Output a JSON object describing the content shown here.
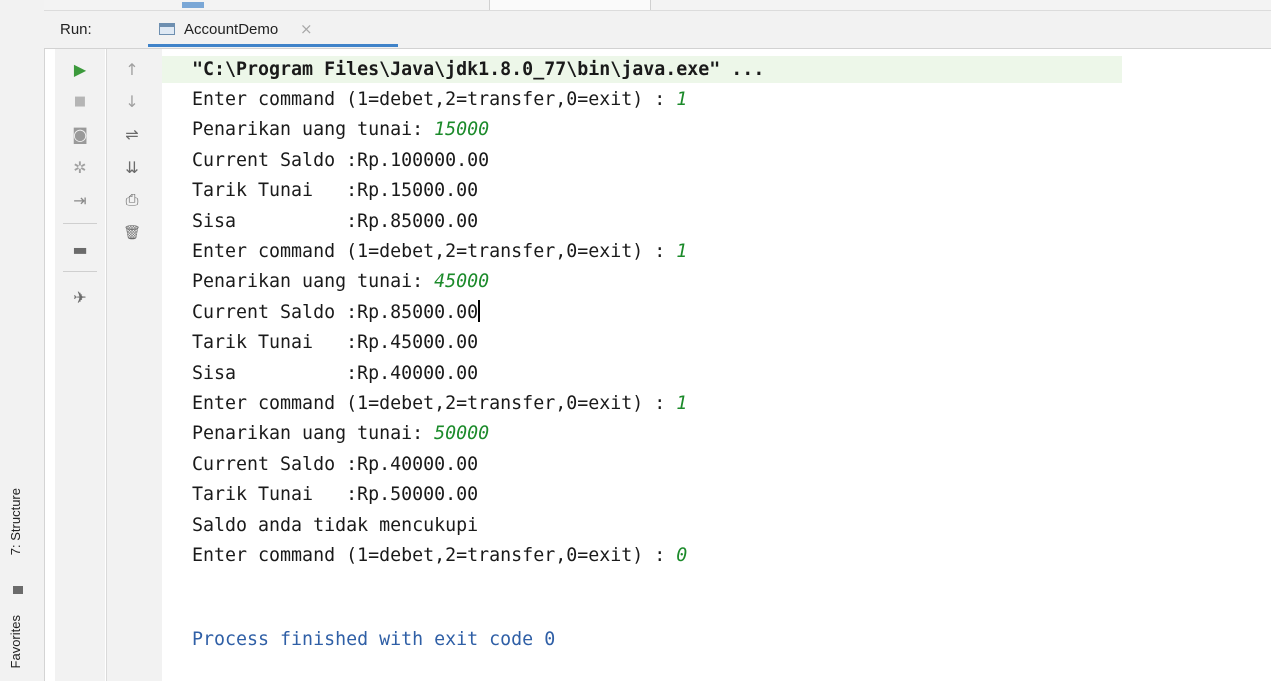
{
  "side": {
    "structure_label": "7: Structure",
    "favorites_label": "Favorites"
  },
  "run_panel": {
    "run_label": "Run:",
    "tab_title": "AccountDemo",
    "tab_close": "×"
  },
  "toolbar_left": [
    {
      "icon": "play-icon",
      "glyph": "▶"
    },
    {
      "icon": "stop-icon",
      "glyph": "■"
    },
    {
      "icon": "camera-icon",
      "glyph": "◙"
    },
    {
      "icon": "debug-icon",
      "glyph": "✲"
    },
    {
      "icon": "exit-login-icon",
      "glyph": "⇥"
    },
    {
      "icon": "layout-icon",
      "glyph": "▬"
    },
    {
      "icon": "pin-icon",
      "glyph": "✈"
    }
  ],
  "toolbar_right": [
    {
      "icon": "arrow-up-icon",
      "glyph": "↑"
    },
    {
      "icon": "arrow-down-icon",
      "glyph": "↓"
    },
    {
      "icon": "soft-wrap-icon",
      "glyph": "⇌"
    },
    {
      "icon": "scroll-to-end-icon",
      "glyph": "⇊"
    },
    {
      "icon": "print-icon",
      "glyph": "⎙"
    },
    {
      "icon": "trash-icon",
      "glyph": "🗑"
    }
  ],
  "console": {
    "command": "\"C:\\Program Files\\Java\\jdk1.8.0_77\\bin\\java.exe\" ...",
    "lines": [
      {
        "text": "Enter command (1=debet,2=transfer,0=exit) : ",
        "input": "1"
      },
      {
        "text": "Penarikan uang tunai: ",
        "input": "15000"
      },
      {
        "text": "Current Saldo :Rp.100000.00",
        "input": ""
      },
      {
        "text": "Tarik Tunai   :Rp.15000.00",
        "input": ""
      },
      {
        "text": "Sisa          :Rp.85000.00",
        "input": ""
      },
      {
        "text": "Enter command (1=debet,2=transfer,0=exit) : ",
        "input": "1"
      },
      {
        "text": "Penarikan uang tunai: ",
        "input": "45000"
      },
      {
        "text": "Current Saldo :Rp.85000.00",
        "input": ""
      },
      {
        "text": "Tarik Tunai   :Rp.45000.00",
        "input": ""
      },
      {
        "text": "Sisa          :Rp.40000.00",
        "input": ""
      },
      {
        "text": "Enter command (1=debet,2=transfer,0=exit) : ",
        "input": "1"
      },
      {
        "text": "Penarikan uang tunai: ",
        "input": "50000"
      },
      {
        "text": "Current Saldo :Rp.40000.00",
        "input": ""
      },
      {
        "text": "Tarik Tunai   :Rp.50000.00",
        "input": ""
      },
      {
        "text": "Saldo anda tidak mencukupi",
        "input": ""
      },
      {
        "text": "Enter command (1=debet,2=transfer,0=exit) : ",
        "input": "0"
      }
    ],
    "finished": "Process finished with exit code 0"
  }
}
